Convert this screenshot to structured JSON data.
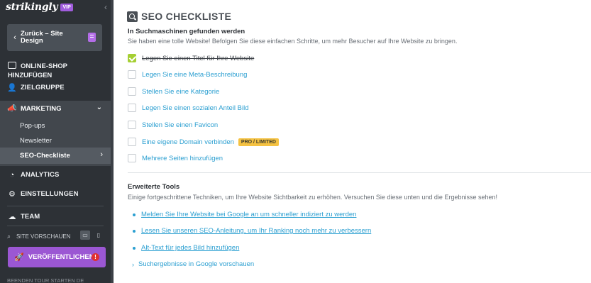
{
  "sidebar": {
    "brand": "strikingly",
    "vip_badge": "VIP",
    "collapse_icon": "chevron-left-icon",
    "back_button": {
      "label": "Zurück – Site Design",
      "icon": "page-icon"
    },
    "shop": {
      "line1": "ONLINE-SHOP",
      "line2": "HINZUFÜGEN",
      "icon": "store-icon"
    },
    "audience": {
      "label": "ZIELGRUPPE",
      "icon": "users-icon"
    },
    "marketing": {
      "label": "MARKETING",
      "icon": "megaphone-icon",
      "items": [
        {
          "label": "Pop-ups"
        },
        {
          "label": "Newsletter"
        }
      ],
      "active_item": "SEO-Checkliste"
    },
    "analytics": {
      "label": "ANALYTICS",
      "icon": "chart-icon"
    },
    "settings": {
      "label": "EINSTELLUNGEN",
      "icon": "gear-icon"
    },
    "team": {
      "label": "TEAM",
      "icon": "team-icon"
    },
    "preview": {
      "label": "SITE VORSCHAUEN",
      "desktop_icon": "desktop-icon",
      "mobile_icon": "mobile-icon"
    },
    "publish": {
      "label": "VERÖFFENTLICHEN",
      "alert": "!"
    },
    "footer": "BEENDEN   TOUR STARTEN   DE"
  },
  "main": {
    "title": "SEO CHECKLISTE",
    "section1": {
      "heading": "In Suchmaschinen gefunden werden",
      "description": "Sie haben eine tolle Website! Befolgen Sie diese einfachen Schritte, um mehr Besucher auf Ihre Website zu bringen.",
      "items": [
        {
          "label": "Legen Sie einen Titel für Ihre Website",
          "checked": true
        },
        {
          "label": "Legen Sie eine Meta-Beschreibung",
          "checked": false
        },
        {
          "label": "Stellen Sie eine Kategorie",
          "checked": false
        },
        {
          "label": "Legen Sie einen sozialen Anteil Bild",
          "checked": false
        },
        {
          "label": "Stellen Sie einen Favicon",
          "checked": false
        },
        {
          "label": "Eine eigene Domain verbinden",
          "checked": false,
          "badge": "PRO / LIMITED"
        },
        {
          "label": "Mehrere Seiten hinzufügen",
          "checked": false
        }
      ]
    },
    "section2": {
      "heading": "Erweiterte Tools",
      "description": "Einige fortgeschrittene Techniken, um Ihre Website Sichtbarkeit zu erhöhen. Versuchen Sie diese unten und die Ergebnisse sehen!",
      "links": [
        "Melden Sie Ihre Website bei Google an um schneller indiziert zu werden",
        "Lesen Sie unseren SEO-Anleitung, um Ihr Ranking noch mehr zu verbessern",
        "Alt-Text für jedes Bild hinzufügen"
      ],
      "expand_link": "Suchergebnisse in Google vorschauen"
    }
  },
  "colors": {
    "sidebar_bg": "#2d3136",
    "accent_purple": "#9b57d3",
    "link_blue": "#2b9fd1",
    "check_green": "#a5cf33",
    "pro_badge": "#f5c242"
  }
}
